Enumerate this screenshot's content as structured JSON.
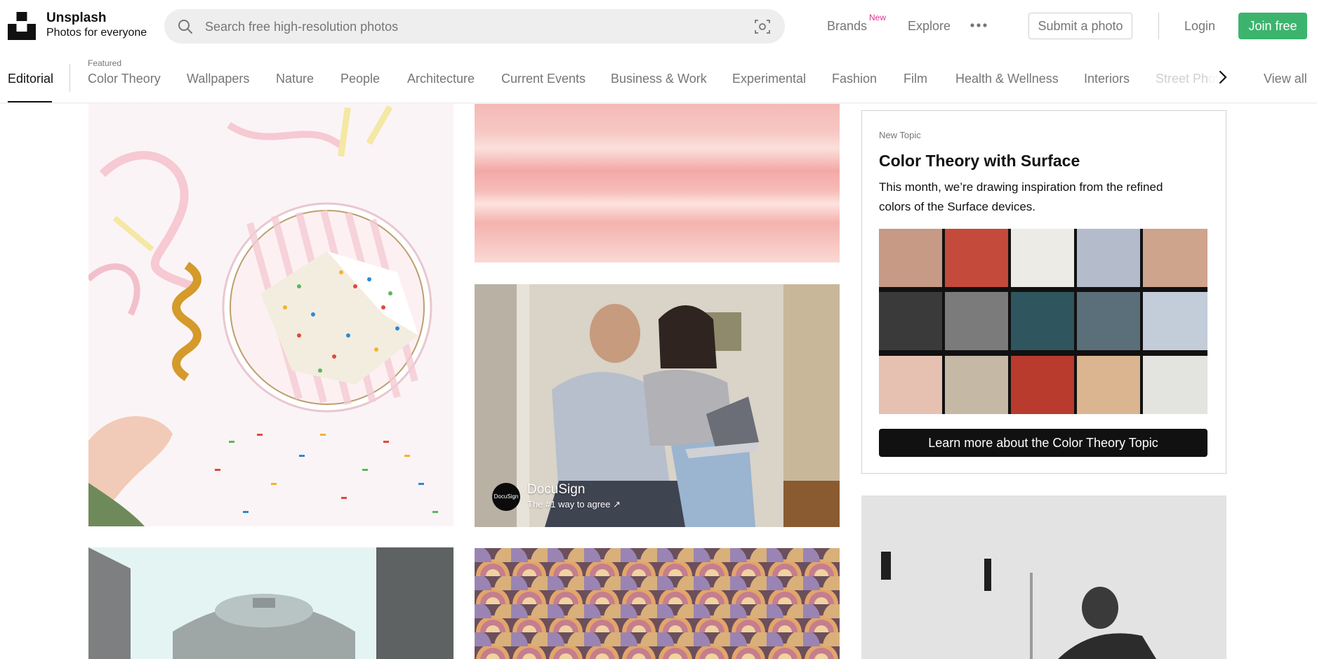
{
  "header": {
    "brand_title": "Unsplash",
    "brand_subtitle": "Photos for everyone",
    "search_placeholder": "Search free high-resolution photos",
    "nav": {
      "brands": "Brands",
      "brands_badge": "New",
      "explore": "Explore",
      "submit": "Submit a photo",
      "login": "Login",
      "join": "Join free"
    }
  },
  "topics": {
    "active": "Editorial",
    "featured_label": "Featured",
    "items": [
      "Color Theory",
      "Wallpapers",
      "Nature",
      "People",
      "Architecture",
      "Current Events",
      "Business & Work",
      "Experimental",
      "Fashion",
      "Film",
      "Health & Wellness",
      "Interiors",
      "Street Phot"
    ],
    "view_all": "View all"
  },
  "sponsored": {
    "avatar_text": "DocuSign",
    "name": "DocuSign",
    "tagline": "The #1 way to agree ↗"
  },
  "promo": {
    "kicker": "New Topic",
    "title": "Color Theory with Surface",
    "description": "This month, we’re drawing inspiration from the refined colors of the Surface devices.",
    "cta": "Learn more about the Color Theory Topic"
  },
  "colors": {
    "join_green": "#3cb46e",
    "new_badge": "#e0309a",
    "text_primary": "#111111",
    "text_muted": "#767676"
  }
}
